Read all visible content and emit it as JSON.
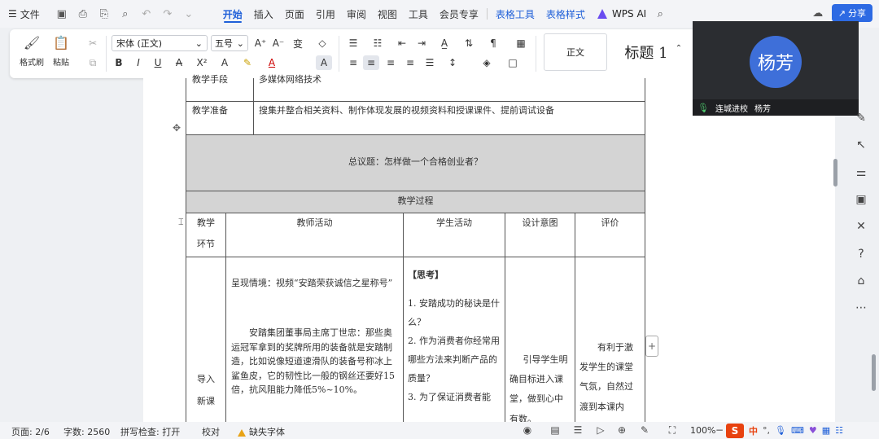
{
  "menubar": {
    "file_label": "文件",
    "tabs": [
      "开始",
      "插入",
      "页面",
      "引用",
      "审阅",
      "视图",
      "工具",
      "会员专享"
    ],
    "context_tabs": [
      "表格工具",
      "表格样式"
    ],
    "wps_ai": "WPS AI",
    "share": "分享"
  },
  "ribbon": {
    "format_painter": "格式刷",
    "paste": "粘贴",
    "font_name": "宋体 (正文)",
    "font_size": "五号",
    "style_normal": "正文",
    "style_heading": "标题 1"
  },
  "document": {
    "row_tech_label": "教学手段",
    "row_tech_value": "多媒体网络技术",
    "row_prep_label": "教学准备",
    "row_prep_value": "搜集并整合相关资料、制作体现发展的视频资料和授课课件、提前调试设备",
    "topic": "总议题：怎样做一个合格创业者？",
    "process_header": "教学过程",
    "col_stage_1": "教学",
    "col_stage_2": "环节",
    "col_teacher": "教师活动",
    "col_student": "学生活动",
    "col_design": "设计意图",
    "col_eval": "评价",
    "stage_intro_1": "导入",
    "stage_intro_2": "新课",
    "teacher_p1": "呈现情境：视频“安踏荣获诚信之星称号”",
    "teacher_p2": "安踏集团董事局主席丁世忠：那些奥运冠军拿到的奖牌所用的装备就是安踏制造，比如说像短道速滑队的装备号称冰上鲨鱼皮，它的韧性比一般的钢丝还要好15倍，抗风阻能力降低5%~10%。",
    "student_title": "【思考】",
    "student_q1": "1. 安踏成功的秘诀是什么？",
    "student_q2": "2. 作为消费者你经常用哪些方法来判断产品的质量？",
    "student_q3": "3. 为了保证消费者能",
    "design_text": "引导学生明确目标进入课堂，做到心中有数。",
    "eval_text": "有利于激发学生的课堂气氛，自然过渡到本课内"
  },
  "video": {
    "avatar_text": "杨芳",
    "school": "连城进校",
    "name": "杨芳"
  },
  "statusbar": {
    "page": "页面: 2/6",
    "words": "字数: 2560",
    "spell": "拼写检查: 打开",
    "proof": "校对",
    "missing_font": "缺失字体",
    "zoom": "100%",
    "ime_lang": "中"
  }
}
